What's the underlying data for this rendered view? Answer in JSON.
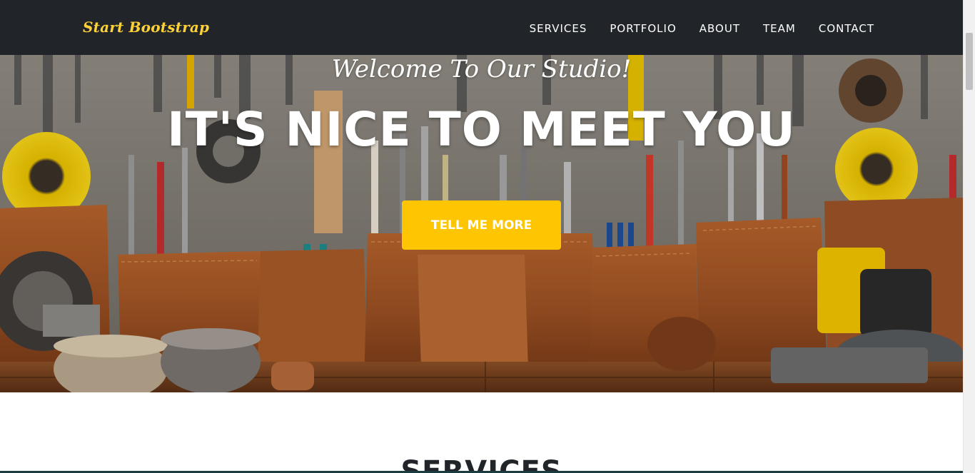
{
  "navbar": {
    "brand": "Start Bootstrap",
    "links": [
      "SERVICES",
      "PORTFOLIO",
      "ABOUT",
      "TEAM",
      "CONTACT"
    ]
  },
  "hero": {
    "subtitle": "Welcome To Our Studio!",
    "title": "IT'S NICE TO MEET YOU",
    "button_label": "TELL ME MORE"
  },
  "services": {
    "heading": "SERVICES"
  },
  "colors": {
    "navbar_bg": "#212529",
    "brand": "#fed136",
    "accent": "#fec503"
  }
}
